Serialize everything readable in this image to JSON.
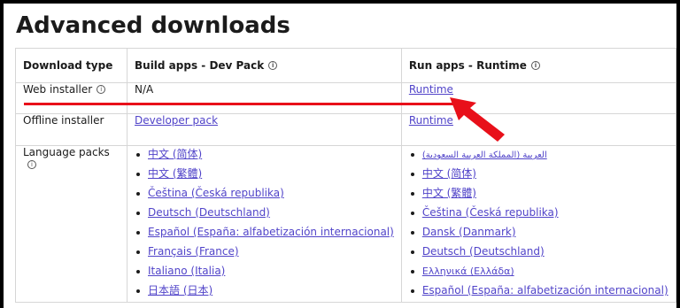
{
  "page_title": "Advanced downloads",
  "table": {
    "headers": [
      "Download type",
      "Build apps - Dev Pack",
      "Run apps - Runtime"
    ],
    "rows": {
      "web_installer": {
        "label": "Web installer",
        "dev_pack": "N/A",
        "runtime": "Runtime"
      },
      "offline_installer": {
        "label": "Offline installer",
        "dev_pack": "Developer pack",
        "runtime": "Runtime"
      },
      "language_packs": {
        "label": "Language packs"
      }
    },
    "dev_pack_languages": [
      "中文 (简体)",
      "中文 (繁體)",
      "Čeština (Česká republika)",
      "Deutsch (Deutschland)",
      "Español (España: alfabetización internacional)",
      "Français (France)",
      "Italiano (Italia)",
      "日本語 (日本)"
    ],
    "runtime_languages": [
      "العربية (المملكة العربية السعودية)",
      "中文 (简体)",
      "中文 (繁體)",
      "Čeština (Česká republika)",
      "Dansk (Danmark)",
      "Deutsch (Deutschland)",
      "Ελληνικά (Ελλάδα)",
      "Español (España: alfabetización internacional)"
    ]
  },
  "info_icon_glyph": "i",
  "annotation_color": "#e8101a",
  "link_color": "#5144c9"
}
